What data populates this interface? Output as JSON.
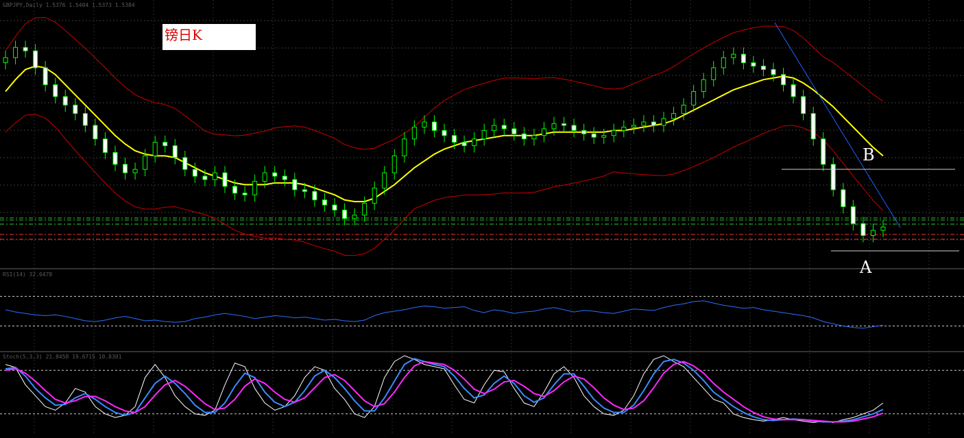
{
  "chart_data": {
    "type": "candlestick",
    "title": "镑日K",
    "annotations": [
      "A",
      "B"
    ],
    "colors": {
      "background": "#000000",
      "candle": "#00ff00",
      "bollinger": "#cc0000",
      "middle_band": "#ffff00",
      "trendline": "#1e60ff",
      "rsi": "#2a70ff",
      "stoch_main": "#ffffff",
      "stoch_fast": "#3a8cff",
      "stoch_signal": "#ff28ff",
      "level_green": "#2ecc2e",
      "level_red": "#ff3030",
      "horizontal": "#cfcfcf"
    },
    "close": [
      1.528,
      1.534,
      1.532,
      1.522,
      1.512,
      1.505,
      1.5,
      1.495,
      1.488,
      1.48,
      1.472,
      1.465,
      1.46,
      1.462,
      1.47,
      1.478,
      1.476,
      1.469,
      1.462,
      1.458,
      1.456,
      1.46,
      1.452,
      1.448,
      1.447,
      1.455,
      1.46,
      1.458,
      1.456,
      1.45,
      1.449,
      1.444,
      1.441,
      1.438,
      1.433,
      1.435,
      1.442,
      1.451,
      1.46,
      1.47,
      1.48,
      1.487,
      1.49,
      1.485,
      1.482,
      1.478,
      1.476,
      1.48,
      1.485,
      1.488,
      1.486,
      1.483,
      1.48,
      1.482,
      1.486,
      1.489,
      1.488,
      1.485,
      1.483,
      1.481,
      1.482,
      1.485,
      1.487,
      1.488,
      1.49,
      1.488,
      1.492,
      1.495,
      1.5,
      1.508,
      1.515,
      1.522,
      1.528,
      1.53,
      1.525,
      1.523,
      1.521,
      1.518,
      1.512,
      1.505,
      1.495,
      1.48,
      1.465,
      1.45,
      1.44,
      1.43,
      1.423,
      1.426,
      1.428
    ],
    "middle_band": [
      1.508,
      1.515,
      1.521,
      1.523,
      1.522,
      1.518,
      1.512,
      1.506,
      1.5,
      1.494,
      1.488,
      1.482,
      1.477,
      1.473,
      1.471,
      1.47,
      1.47,
      1.469,
      1.466,
      1.463,
      1.46,
      1.458,
      1.456,
      1.454,
      1.453,
      1.453,
      1.453,
      1.454,
      1.454,
      1.454,
      1.453,
      1.451,
      1.449,
      1.447,
      1.444,
      1.443,
      1.443,
      1.445,
      1.449,
      1.453,
      1.458,
      1.463,
      1.467,
      1.471,
      1.474,
      1.476,
      1.478,
      1.479,
      1.48,
      1.481,
      1.482,
      1.482,
      1.482,
      1.482,
      1.483,
      1.484,
      1.484,
      1.484,
      1.484,
      1.484,
      1.484,
      1.485,
      1.485,
      1.486,
      1.487,
      1.488,
      1.489,
      1.491,
      1.494,
      1.497,
      1.5,
      1.503,
      1.506,
      1.509,
      1.511,
      1.513,
      1.515,
      1.516,
      1.517,
      1.516,
      1.513,
      1.509,
      1.504,
      1.499,
      1.493,
      1.487,
      1.481,
      1.475,
      1.47
    ],
    "rsi": [
      52,
      49,
      47,
      45,
      44,
      45,
      43,
      40,
      37,
      36,
      38,
      41,
      43,
      40,
      37,
      38,
      36,
      35,
      36,
      40,
      42,
      45,
      47,
      45,
      43,
      40,
      42,
      44,
      43,
      41,
      42,
      40,
      38,
      39,
      37,
      36,
      38,
      44,
      48,
      50,
      52,
      55,
      57,
      56,
      54,
      55,
      56,
      51,
      48,
      52,
      50,
      47,
      49,
      50,
      53,
      55,
      52,
      49,
      51,
      50,
      48,
      47,
      50,
      53,
      52,
      51,
      55,
      58,
      60,
      63,
      64,
      61,
      58,
      56,
      54,
      55,
      52,
      50,
      48,
      46,
      44,
      41,
      36,
      33,
      30,
      28,
      27,
      29,
      31
    ],
    "stoch_main": [
      88,
      84,
      60,
      45,
      30,
      25,
      35,
      55,
      50,
      30,
      20,
      15,
      18,
      30,
      70,
      88,
      70,
      45,
      30,
      20,
      18,
      25,
      60,
      90,
      85,
      55,
      35,
      25,
      30,
      45,
      70,
      85,
      80,
      55,
      40,
      20,
      15,
      30,
      70,
      92,
      100,
      95,
      88,
      85,
      82,
      60,
      40,
      35,
      60,
      80,
      78,
      55,
      35,
      30,
      50,
      75,
      85,
      70,
      45,
      30,
      20,
      18,
      25,
      45,
      75,
      95,
      100,
      92,
      85,
      70,
      55,
      40,
      35,
      20,
      15,
      12,
      10,
      12,
      15,
      12,
      10,
      8,
      10,
      8,
      12,
      15,
      20,
      25,
      35
    ],
    "stoch_fast": [
      82,
      84,
      72,
      55,
      42,
      32,
      33,
      42,
      48,
      40,
      30,
      22,
      18,
      22,
      42,
      62,
      72,
      62,
      48,
      32,
      22,
      22,
      35,
      58,
      76,
      70,
      50,
      36,
      30,
      36,
      52,
      72,
      80,
      70,
      55,
      38,
      24,
      24,
      42,
      65,
      88,
      96,
      92,
      88,
      85,
      72,
      55,
      42,
      46,
      62,
      72,
      62,
      45,
      36,
      42,
      60,
      75,
      75,
      58,
      40,
      28,
      22,
      22,
      32,
      52,
      75,
      92,
      95,
      90,
      80,
      66,
      50,
      40,
      30,
      22,
      16,
      12,
      11,
      12,
      13,
      12,
      10,
      9,
      9,
      10,
      12,
      16,
      20,
      26
    ],
    "stoch_signal": [
      80,
      82,
      76,
      65,
      52,
      40,
      35,
      38,
      44,
      44,
      38,
      30,
      24,
      22,
      30,
      46,
      60,
      66,
      58,
      46,
      34,
      26,
      28,
      40,
      58,
      68,
      62,
      50,
      40,
      36,
      42,
      56,
      70,
      74,
      66,
      52,
      38,
      30,
      34,
      50,
      70,
      86,
      92,
      90,
      88,
      80,
      68,
      54,
      48,
      54,
      64,
      66,
      58,
      48,
      44,
      52,
      64,
      72,
      68,
      56,
      42,
      32,
      26,
      28,
      38,
      56,
      76,
      88,
      92,
      86,
      76,
      62,
      50,
      40,
      30,
      22,
      16,
      13,
      12,
      12,
      12,
      11,
      10,
      9,
      9,
      10,
      13,
      16,
      21
    ]
  },
  "header_texts": {
    "main": "GBPJPY,Daily 1.5376 1.5404 1.5373 1.5384",
    "rsi": "RSI(14) 32.6478",
    "stoch": "Stoch(5,3,3) 21.8458 19.6715 10.8301"
  }
}
